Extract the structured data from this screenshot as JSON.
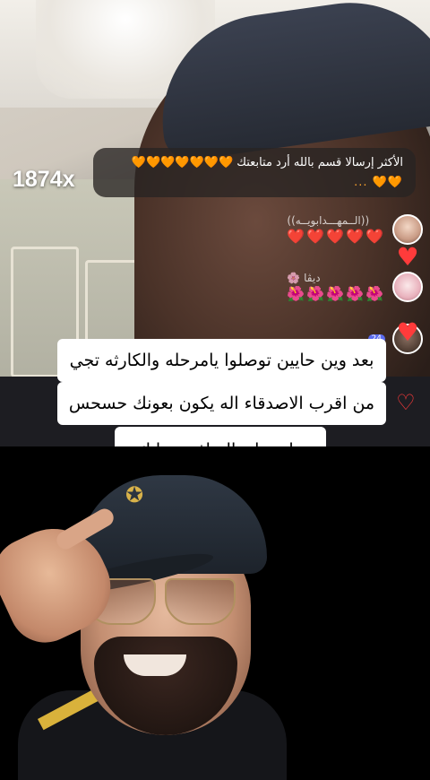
{
  "live": {
    "multiplier": "1874x"
  },
  "pinned_comment": {
    "text": "الأكثر إرسالا قسم بالله أرد متابعتك",
    "hearts_inline": "🧡🧡🧡🧡🧡🧡🧡",
    "hearts_trailing": "🧡🧡 ..."
  },
  "comments": [
    {
      "username": "((الــمهـــدابويــه))",
      "message": "❤️❤️❤️❤️❤️"
    },
    {
      "username": "ديڤا 🌸",
      "message": "🌺🌺🌺🌺🌺"
    },
    {
      "username": "",
      "message": "",
      "badge": "24"
    }
  ],
  "caption": {
    "line1": "بعد وين حايين توصلوا يامرحله  والكارثه تجي",
    "line2": "من اقرب الاصدقاء اله يكون بعونك حسحس",
    "line3": "على هاي النماذج  بحياتك"
  },
  "colors": {
    "caption_bg": "#ffffff",
    "heart_red": "#ff2a44",
    "heart_orange": "#f4a02c"
  }
}
